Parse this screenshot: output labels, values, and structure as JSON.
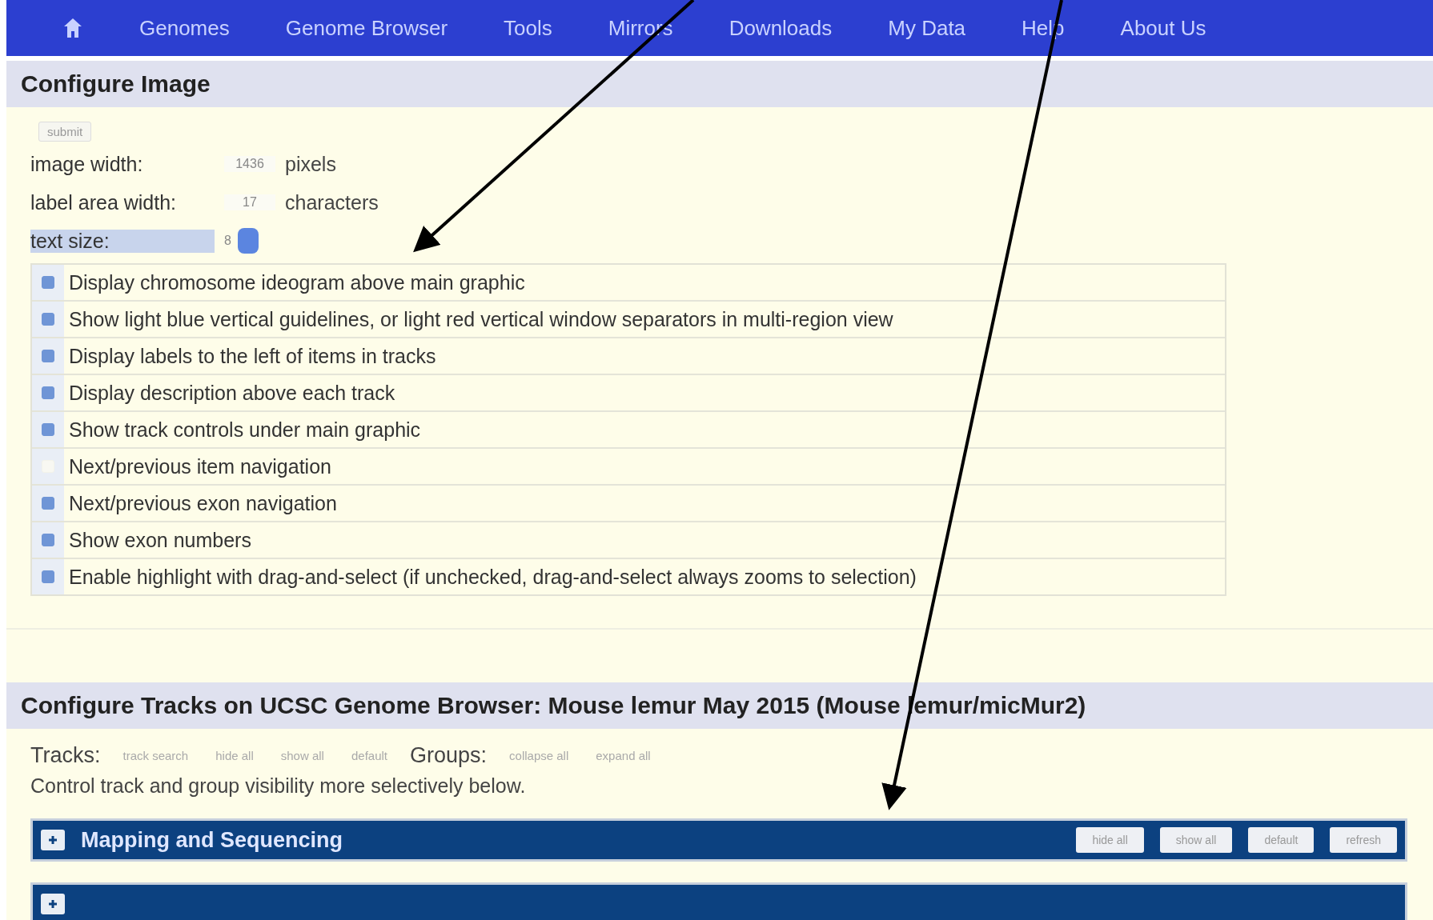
{
  "nav": {
    "items": [
      {
        "kind": "home"
      },
      {
        "kind": "link",
        "label": "Genomes"
      },
      {
        "kind": "link",
        "label": "Genome Browser"
      },
      {
        "kind": "link",
        "label": "Tools"
      },
      {
        "kind": "link",
        "label": "Mirrors"
      },
      {
        "kind": "link",
        "label": "Downloads"
      },
      {
        "kind": "link",
        "label": "My Data"
      },
      {
        "kind": "link",
        "label": "Help"
      },
      {
        "kind": "link",
        "label": "About Us"
      }
    ]
  },
  "configure_image": {
    "title": "Configure Image",
    "submit": "submit",
    "fields": [
      {
        "kind": "input",
        "label": "image width:",
        "value": "1436",
        "unit": "pixels",
        "highlighted": false
      },
      {
        "kind": "input",
        "label": "label area width:",
        "value": "17",
        "unit": "characters",
        "highlighted": false
      },
      {
        "kind": "select",
        "label": "text size:",
        "value": "8",
        "highlighted": true
      }
    ],
    "options": [
      {
        "label": "Display chromosome ideogram above main graphic",
        "checked": true
      },
      {
        "label": "Show light blue vertical guidelines, or light red vertical window separators in multi-region view",
        "checked": true
      },
      {
        "label": "Display labels to the left of items in tracks",
        "checked": true
      },
      {
        "label": "Display description above each track",
        "checked": true
      },
      {
        "label": "Show track controls under main graphic",
        "checked": true
      },
      {
        "label": "Next/previous item navigation",
        "checked": false
      },
      {
        "label": "Next/previous exon navigation",
        "checked": true
      },
      {
        "label": "Show exon numbers",
        "checked": true
      },
      {
        "label": "Enable highlight with drag-and-select (if unchecked, drag-and-select always zooms to selection)",
        "checked": true
      }
    ]
  },
  "configure_tracks": {
    "title": "Configure Tracks on UCSC Genome Browser: Mouse lemur May 2015 (Mouse lemur/micMur2)",
    "tracks_label": "Tracks:",
    "track_buttons": [
      "track search",
      "hide all",
      "show all",
      "default"
    ],
    "groups_label": "Groups:",
    "group_buttons": [
      "collapse all",
      "expand all"
    ],
    "hint": "Control track and group visibility more selectively below.",
    "groups": [
      {
        "title": "Mapping and Sequencing",
        "expanded": false,
        "buttons": [
          "hide all",
          "show all",
          "default",
          "refresh"
        ]
      },
      {
        "expanded": false
      }
    ]
  }
}
